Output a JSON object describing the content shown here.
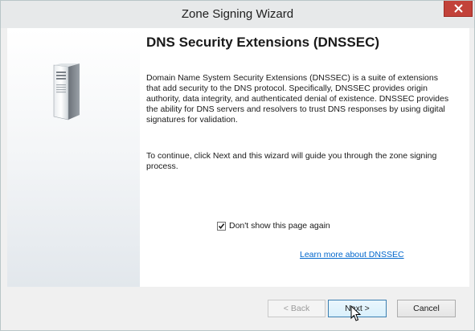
{
  "window": {
    "title": "Zone Signing Wizard",
    "close_icon": "close-icon"
  },
  "side_panel": {
    "image_icon": "server-icon"
  },
  "main": {
    "heading": "DNS Security Extensions (DNSSEC)",
    "paragraph1": "Domain Name System Security Extensions (DNSSEC) is a suite of extensions that add security to the DNS protocol. Specifically, DNSSEC provides origin authority, data integrity, and authenticated denial of existence. DNSSEC provides the ability for DNS servers and resolvers to trust DNS responses by using digital signatures for validation.",
    "paragraph2": "To continue, click Next and this wizard will guide you through the zone signing process.",
    "checkbox": {
      "label": "Don't show this page again",
      "checked": true
    },
    "learn_more_link": "Learn more about DNSSEC"
  },
  "buttons": {
    "back": "< Back",
    "next": "Next >",
    "cancel": "Cancel"
  },
  "colors": {
    "link": "#0066cc",
    "close_button": "#c2423a",
    "next_border": "#3c7fb1"
  }
}
